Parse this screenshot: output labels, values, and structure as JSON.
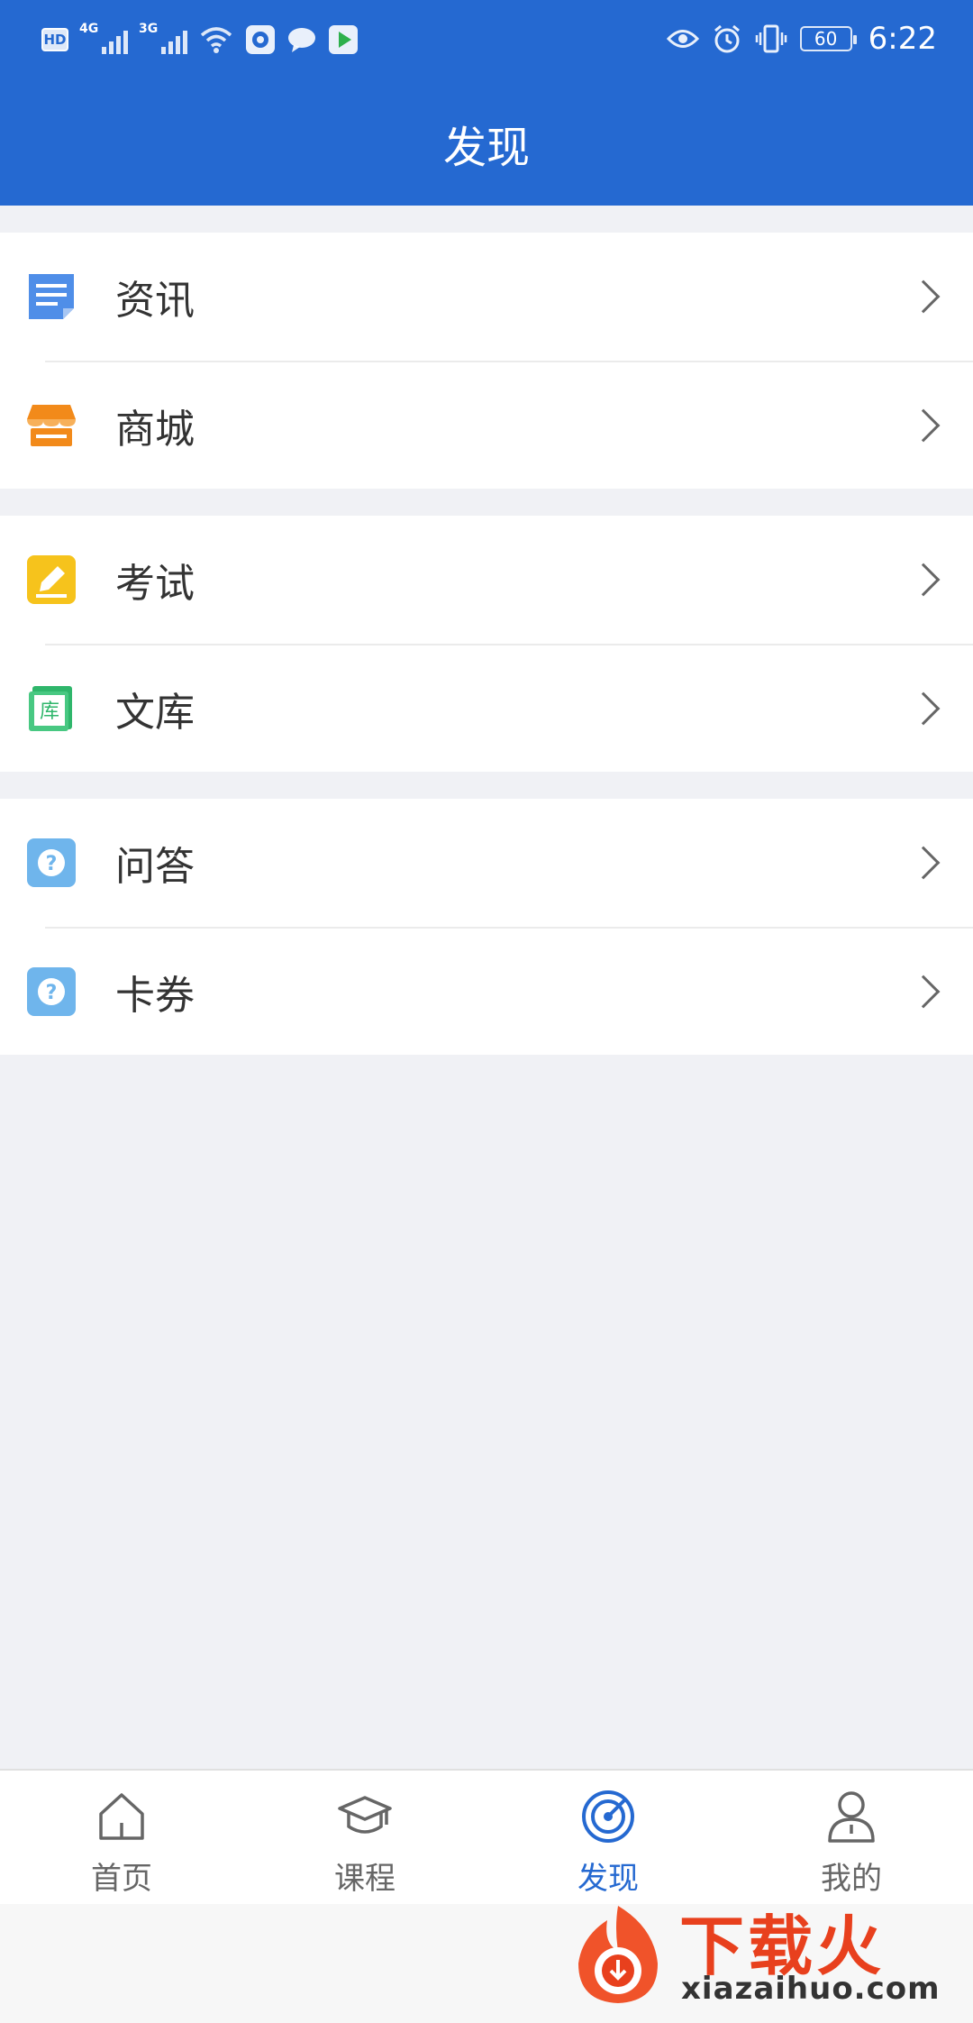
{
  "status_bar": {
    "hd": "HD",
    "signal1": "4G",
    "signal2": "3G",
    "battery": "60",
    "time": "6:22"
  },
  "header": {
    "title": "发现"
  },
  "groups": [
    {
      "items": [
        {
          "label": "资讯",
          "icon": "document-list-icon"
        },
        {
          "label": "商城",
          "icon": "shop-icon"
        }
      ]
    },
    {
      "items": [
        {
          "label": "考试",
          "icon": "exam-pencil-icon"
        },
        {
          "label": "文库",
          "icon": "library-book-icon"
        }
      ]
    },
    {
      "items": [
        {
          "label": "问答",
          "icon": "question-icon"
        },
        {
          "label": "卡券",
          "icon": "question-icon"
        }
      ]
    }
  ],
  "tabbar": {
    "items": [
      {
        "label": "首页",
        "icon": "home-icon"
      },
      {
        "label": "课程",
        "icon": "graduation-cap-icon"
      },
      {
        "label": "发现",
        "icon": "discover-radar-icon",
        "active": true
      },
      {
        "label": "我的",
        "icon": "user-icon"
      }
    ],
    "active_color": "#2569d1"
  },
  "watermark": {
    "brand": "下载火",
    "url": "xiazaihuo.com"
  },
  "colors": {
    "primary": "#2569d1",
    "background": "#f0f1f5"
  }
}
